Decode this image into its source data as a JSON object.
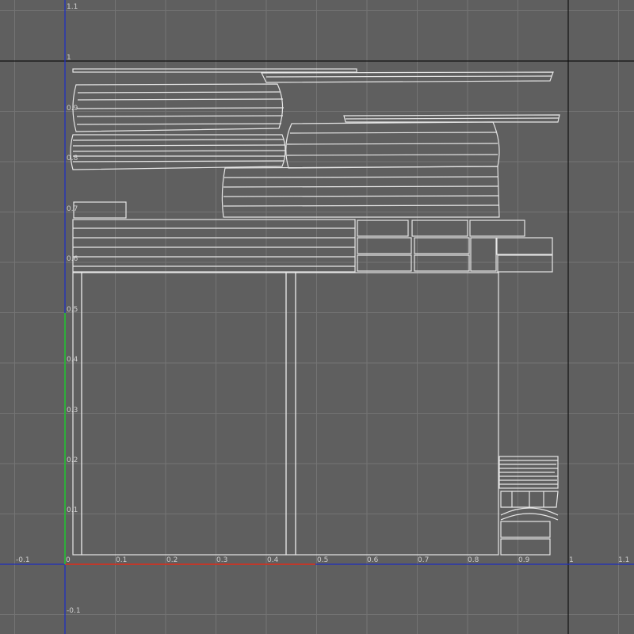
{
  "uv_editor": {
    "x_tick_labels": [
      "-0.1",
      "0",
      "0.1",
      "0.2",
      "0.3",
      "0.4",
      "0.5",
      "0.6",
      "0.7",
      "0.8",
      "0.9",
      "1",
      "1.1"
    ],
    "y_tick_labels": [
      "1.1",
      "1",
      "0.9",
      "0.8",
      "0.7",
      "0.6",
      "0.5",
      "0.4",
      "0.3",
      "0.2",
      "0.1",
      "-0.1"
    ],
    "colors": {
      "background": "#5f5f5f",
      "grid": "#747474",
      "origin_axis": "#1f2fbf",
      "unit_border": "#111111",
      "u_axis": "#c0392b",
      "v_axis": "#2fae3b",
      "uv_wire": "#e6e6e6"
    }
  }
}
